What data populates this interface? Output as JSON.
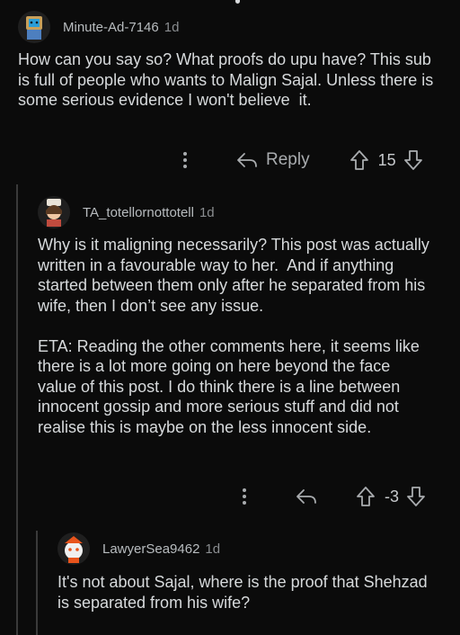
{
  "comments": [
    {
      "username": "Minute-Ad-7146",
      "age": "1d",
      "body": "How can you say so? What proofs do upu have? This sub is full of people who wants to Malign Sajal. Unless there is some serious evidence I won't believe  it.",
      "reply_label": "Reply",
      "score": "15"
    },
    {
      "username": "TA_totellornottotell",
      "age": "1d",
      "body": "Why is it maligning necessarily? This post was actually written in a favourable way to her.  And if anything started between them only after he separated from his wife, then I don’t see any issue.\n\nETA: Reading the other comments here, it seems like there is a lot more going on here beyond the face value of this post. I do think there is a line between innocent gossip and more serious stuff and did not realise this is maybe on the less innocent side.",
      "score": "-3"
    },
    {
      "username": "LawyerSea9462",
      "age": "1d",
      "body": "It's not about Sajal, where is the proof that Shehzad is separated from his wife?"
    }
  ],
  "icons": {
    "more": "more-options-icon",
    "reply": "reply-arrow-icon",
    "upvote": "upvote-arrow-icon",
    "downvote": "downvote-arrow-icon"
  },
  "colors": {
    "background": "#0b0b0b",
    "text": "#d7dadc",
    "muted": "#8a8d90"
  }
}
